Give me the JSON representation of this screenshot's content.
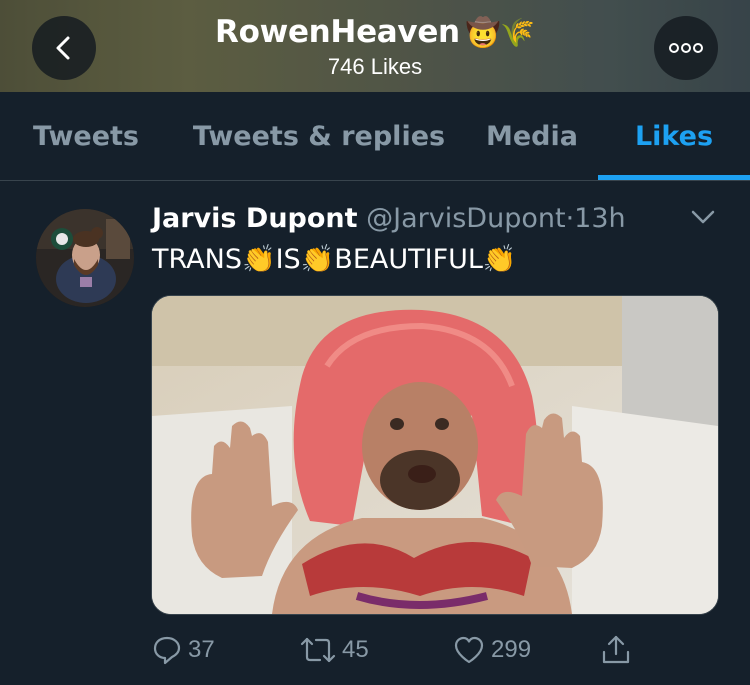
{
  "header": {
    "title": "RowenHeaven",
    "title_emoji": "🤠🌾",
    "subtitle": "746 Likes",
    "back_icon": "chevron-left-icon",
    "more_icon": "ellipsis-icon"
  },
  "tabs": [
    {
      "label": "Tweets",
      "active": false
    },
    {
      "label": "Tweets & replies",
      "active": false
    },
    {
      "label": "Media",
      "active": false
    },
    {
      "label": "Likes",
      "active": true
    }
  ],
  "tweet": {
    "author_name": "Jarvis Dupont",
    "author_handle": "@JarvisDupont",
    "separator": "·",
    "time": "13h",
    "text": "TRANS👏IS👏BEAUTIFUL👏",
    "replies": "37",
    "retweets": "45",
    "likes": "299"
  },
  "colors": {
    "background": "#15202b",
    "accent": "#1da1f2",
    "muted": "#8899a6",
    "border": "#38444d"
  }
}
